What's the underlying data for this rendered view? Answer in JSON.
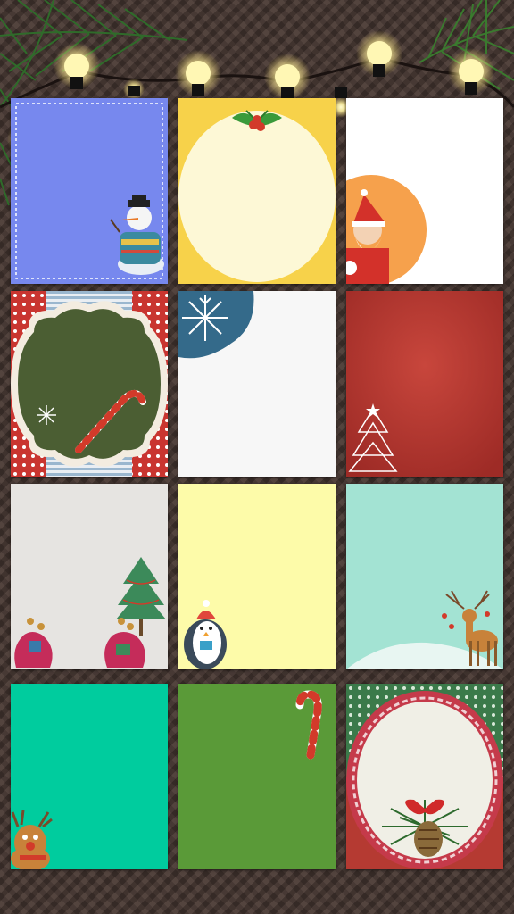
{
  "gallery": {
    "cards": [
      {
        "id": "snowman-blue",
        "icon": "snowman-icon",
        "background": "#7788ee"
      },
      {
        "id": "holly-yellow",
        "icon": "holly-icon",
        "background": "#f7d24a"
      },
      {
        "id": "santa-white",
        "icon": "santa-icon",
        "background": "#ffffff"
      },
      {
        "id": "candy-cane-green-label",
        "icon": "candy-cane-icon",
        "background": "#4b5e33"
      },
      {
        "id": "snowflake-white",
        "icon": "snowflake-icon",
        "background": "#f7f7f7"
      },
      {
        "id": "tree-red",
        "icon": "christmas-tree-icon",
        "background": "#b53a32"
      },
      {
        "id": "gift-bags-grey",
        "icon": "gift-bag-icon",
        "background": "#e6e4e1"
      },
      {
        "id": "penguin-yellow",
        "icon": "penguin-icon",
        "background": "#fdfba9"
      },
      {
        "id": "reindeer-mint",
        "icon": "reindeer-icon",
        "background": "#a3e3d3"
      },
      {
        "id": "rudolph-teal",
        "icon": "reindeer-icon",
        "background": "#00cc9e"
      },
      {
        "id": "candy-cane-green",
        "icon": "candy-cane-icon",
        "background": "#5a9a38"
      },
      {
        "id": "pinecone-wreath",
        "icon": "pinecone-icon",
        "background": "#e8e6de"
      }
    ],
    "lights": {
      "color": "#fff6a8",
      "count": 8
    }
  }
}
